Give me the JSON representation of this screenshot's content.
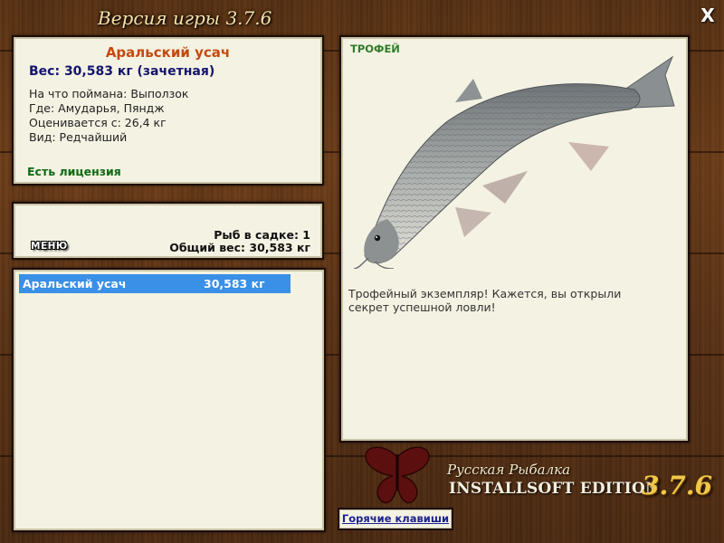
{
  "window": {
    "title": "Версия игры 3.7.6",
    "close_label": "X"
  },
  "fish_info": {
    "name": "Аральский усач",
    "weight": "Вес: 30,583 кг (зачетная)",
    "caught_on": "На что поймана: Выползок",
    "location": "Где: Амударья, Пяндж",
    "rated_from": "Оценивается с: 26,4 кг",
    "kind": "Вид: Редчайший",
    "license": "Есть лицензия"
  },
  "keepnet": {
    "menu_label": "МЕНЮ",
    "count": "Рыб в садке: 1",
    "total_weight": "Общий вес: 30,583 кг"
  },
  "catch_list": [
    {
      "name": "Аральский усач",
      "weight": "30,583 кг"
    }
  ],
  "trophy": {
    "label": "ТРОФЕЙ",
    "image_icon": "fish-barbel-image",
    "description": "Трофейный экземпляр! Кажется, вы открыли секрет успешной ловли!"
  },
  "brand": {
    "line1": "Русская Рыбалка",
    "line2": "INSTALLSOFT EDITION",
    "version": "3.7.6",
    "logo_icon": "butterfly-icon"
  },
  "hotkeys_label": "Горячие клавиши"
}
